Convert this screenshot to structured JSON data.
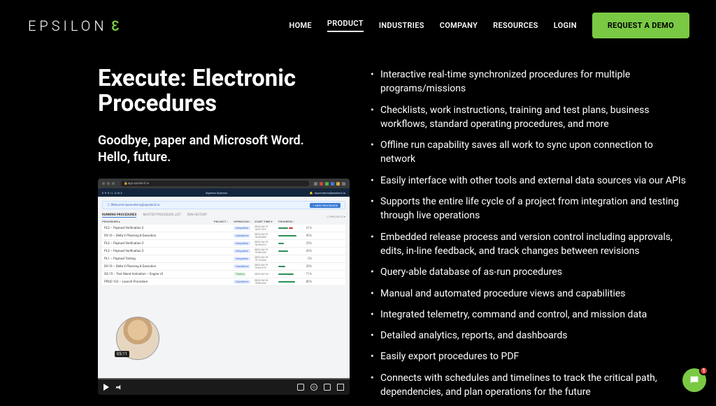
{
  "brand": {
    "pre": "EPSILON",
    "accent": "3"
  },
  "nav": {
    "items": [
      "HOME",
      "PRODUCT",
      "INDUSTRIES",
      "COMPANY",
      "RESOURCES",
      "LOGIN"
    ],
    "active": "PRODUCT",
    "cta": "REQUEST A DEMO"
  },
  "hero": {
    "title_line1": "Execute: Electronic",
    "title_line2": "Procedures",
    "subtitle_line1": "Goodbye, paper and Microsoft Word.",
    "subtitle_line2": "Hello, future."
  },
  "features": [
    "Interactive real-time synchronized procedures for multiple programs/missions",
    "Checklists, work instructions, training and test plans, business workflows, standard operating procedures, and more",
    "Offline run capability saves all work to sync upon connection to network",
    "Easily interface with other tools and external data sources via our APIs",
    "Supports the entire life cycle of a project from integration and testing through live operations",
    "Embedded release process and version control including approvals, edits, in-line feedback, and track changes between revisions",
    "Query-able database of as-run procedures",
    "Manual and automated procedure views and capabilities",
    "Integrated telemetry, command and control, and mission data",
    "Detailed analytics, reports, and dashboards",
    "Easily export procedures to PDF",
    "Connects with schedules and timelines to track the critical path, dependencies, and plan operations for the future"
  ],
  "video": {
    "url": "app.epsilon3.io",
    "app_brand": "EPSILON3",
    "org": "Irigelens Systems",
    "user": "laura+demo@epsilon3.io",
    "welcome": "Welcome laura+demo@epsilon3.io",
    "new_procedure": "+ NEW PROCEDURE",
    "tabs": [
      "RUNNING PROCEDURES",
      "MASTER PROCEDURE LIST",
      "RUN HISTORY"
    ],
    "filter": "☐ PROJECTS ▾",
    "headers": [
      "PROCEDURE ▴",
      "PROJECT ↕",
      "OPERATION ↕",
      "START TIME ▾",
      "PROGRESS ↕",
      ""
    ],
    "rows": [
      {
        "name": "PL2 – Payload Verification 2",
        "project": "",
        "op": "Integration",
        "time": "2022-04-19\n16:57:572",
        "pct": "31%",
        "bars": [
          [
            "#2e8b57",
            14
          ],
          [
            "#c0392b",
            6
          ]
        ]
      },
      {
        "name": "DV.10 – Delta V Planning & Execution",
        "project": "",
        "op": "Operations",
        "time": "2022-04-19\n16:20:062",
        "pct": "90%",
        "bars": [
          [
            "#2e8b57",
            26
          ]
        ]
      },
      {
        "name": "PL2 – Payload Verification 2",
        "project": "",
        "op": "Integration",
        "time": "2022-04-19\n16:20:012",
        "pct": "25%",
        "bars": [
          [
            "#2e8b57",
            8
          ]
        ]
      },
      {
        "name": "PL2 – Payload Verification 2",
        "project": "",
        "op": "Integration",
        "time": "2022-04-19\n19:58:202",
        "pct": "42%",
        "bars": [
          [
            "#2e8b57",
            14
          ]
        ]
      },
      {
        "name": "PL1 – Payload Testing",
        "project": "",
        "op": "Integration",
        "time": "2022-04-18\n19:19:442",
        "pct": "0%",
        "bars": []
      },
      {
        "name": "DV.10 – Delta V Planning & Execution",
        "project": "",
        "op": "Operations",
        "time": "2022-04-19\n19:03:272",
        "pct": "30%",
        "bars": [
          [
            "#2e8b57",
            10
          ]
        ]
      },
      {
        "name": "GS.15 – Test Stand Activation – Engine v2",
        "project": "",
        "op": "Testing",
        "time": "2022-04-18\n--",
        "pct": "71%",
        "bars": [
          [
            "#2e8b57",
            22
          ]
        ]
      },
      {
        "name": "PROC-123 – Launch Procedure",
        "project": "",
        "op": "Operations",
        "time": "2022-04-18\n15:53:442",
        "pct": "80%",
        "bars": [
          [
            "#2e8b57",
            24
          ]
        ]
      }
    ],
    "elapsed": "05:11"
  },
  "chat": {
    "badge": "1"
  }
}
